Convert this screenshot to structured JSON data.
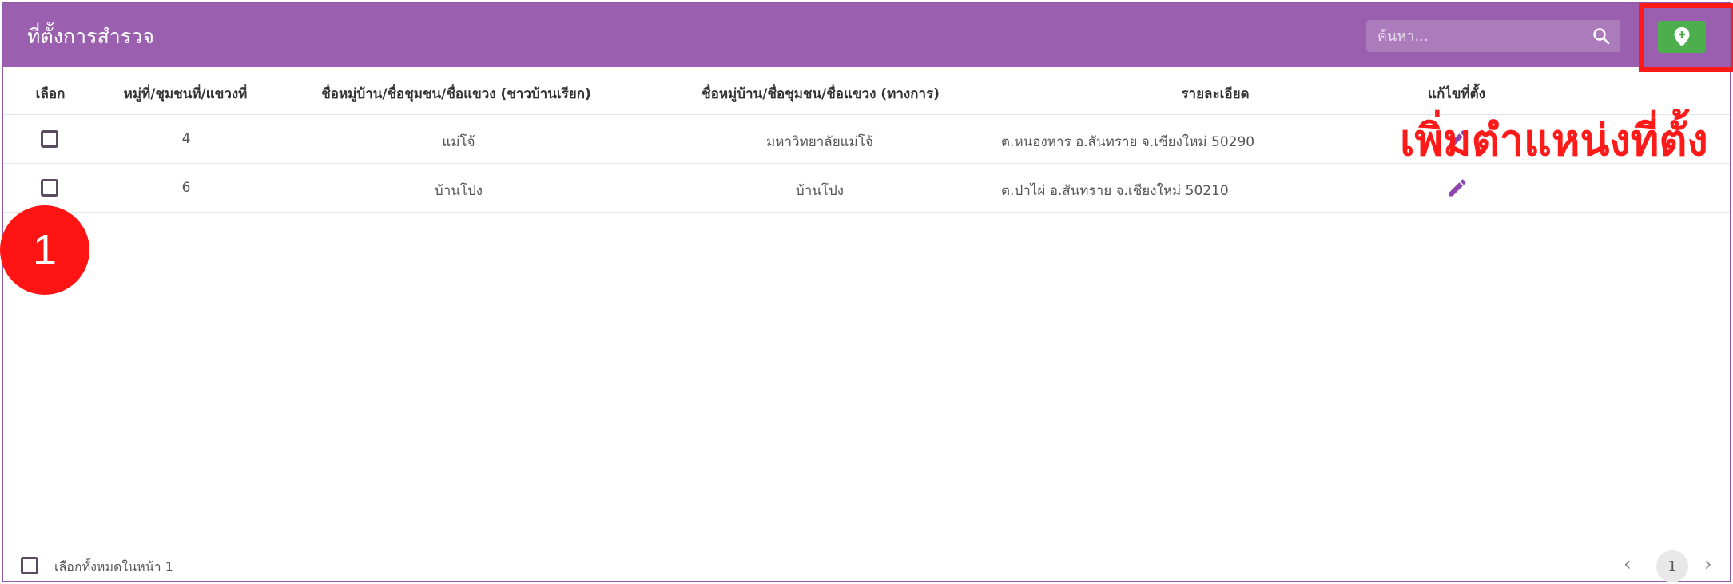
{
  "header": {
    "title": "ที่ตั้งการสำรวจ",
    "search_placeholder": "ค้นหา..."
  },
  "table": {
    "columns": [
      "เลือก",
      "หมู่ที่/ชุมชนที่/แขวงที่",
      "ชื่อหมู่บ้าน/ชื่อชุมชน/ชื่อแขวง (ชาวบ้านเรียก)",
      "ชื่อหมู่บ้าน/ชื่อชุมชน/ชื่อแขวง (ทางการ)",
      "รายละเอียด",
      "แก้ไขที่ตั้ง"
    ],
    "rows": [
      {
        "number": "4",
        "local_name": "แม่โจ้",
        "official_name": "มหาวิทยาลัยแม่โจ้",
        "detail": "ต.หนองหาร อ.สันทราย จ.เชียงใหม่ 50290"
      },
      {
        "number": "6",
        "local_name": "บ้านโปง",
        "official_name": "บ้านโปง",
        "detail": "ต.ป่าไผ่ อ.สันทราย จ.เชียงใหม่ 50210"
      }
    ]
  },
  "annotation": {
    "add_location_label": "เพิ่มตำแหน่งที่ตั้ง",
    "step_number": "1"
  },
  "footer": {
    "select_all_label": "เลือกทั้งหมดในหน้า 1",
    "prev": "‹",
    "current_page": "1",
    "next": "›"
  },
  "colors": {
    "header": "#9a5fae",
    "add_button": "#4cae4c",
    "highlight": "#ff1a1a",
    "edit_icon": "#8e44ad"
  },
  "icons": {
    "search": "search-icon",
    "add_location": "map-marker-plus-icon",
    "edit": "pencil-icon"
  }
}
